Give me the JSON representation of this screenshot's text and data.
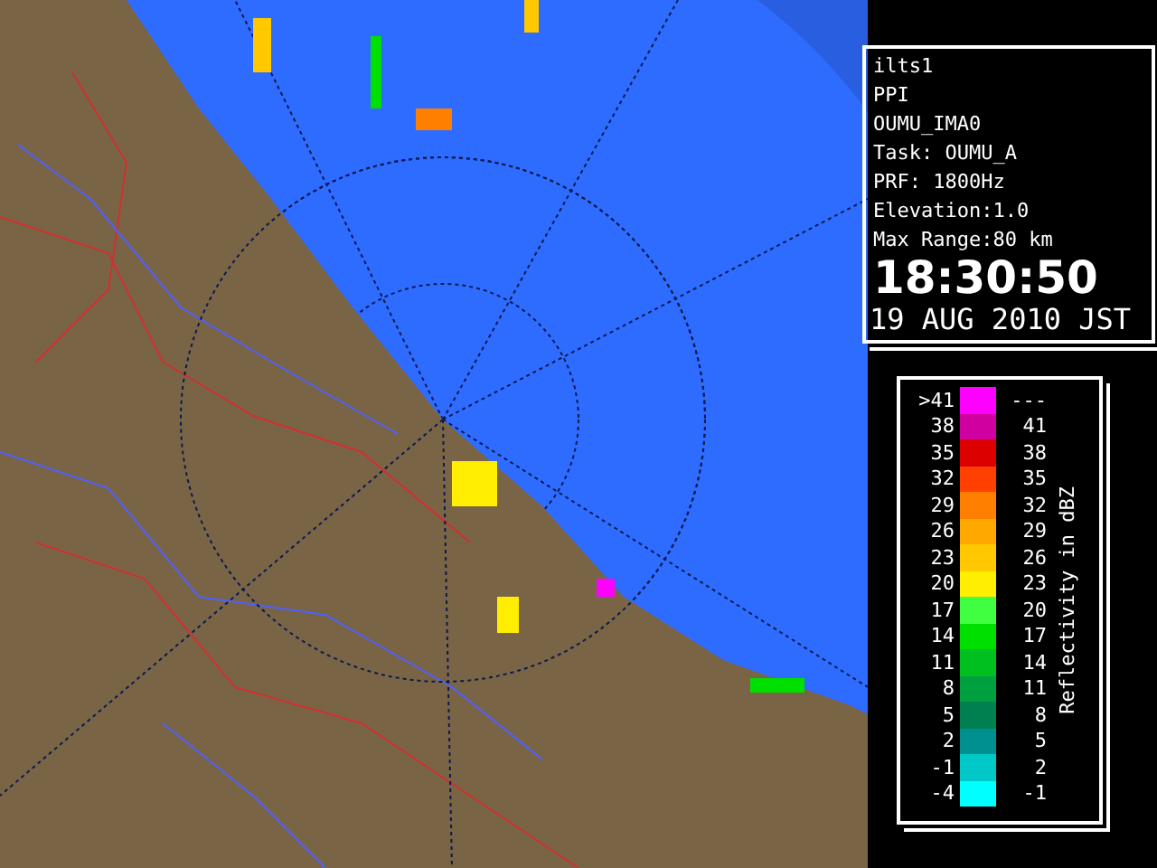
{
  "info": {
    "lines": [
      "ilts1",
      "PPI",
      "OUMU_IMA0",
      "Task: OUMU_A",
      "PRF: 1800Hz",
      "Elevation:1.0",
      "Max Range:80 km"
    ],
    "time": "18:30:50",
    "date": "19 AUG 2010 JST"
  },
  "legend": {
    "title": "Reflectivity in dBZ",
    "rows": [
      {
        "low": ">41",
        "high": "---",
        "color": "#ff00ff"
      },
      {
        "low": "38",
        "high": "41",
        "color": "#d000a0"
      },
      {
        "low": "35",
        "high": "38",
        "color": "#dd0000"
      },
      {
        "low": "32",
        "high": "35",
        "color": "#ff4000"
      },
      {
        "low": "29",
        "high": "32",
        "color": "#ff8000"
      },
      {
        "low": "26",
        "high": "29",
        "color": "#ffa800"
      },
      {
        "low": "23",
        "high": "26",
        "color": "#ffc800"
      },
      {
        "low": "20",
        "high": "23",
        "color": "#ffee00"
      },
      {
        "low": "17",
        "high": "20",
        "color": "#40ff40"
      },
      {
        "low": "14",
        "high": "17",
        "color": "#00e000"
      },
      {
        "low": "11",
        "high": "14",
        "color": "#00c020"
      },
      {
        "low": "8",
        "high": "11",
        "color": "#00a040"
      },
      {
        "low": "5",
        "high": "8",
        "color": "#008050"
      },
      {
        "low": "2",
        "high": "5",
        "color": "#009090"
      },
      {
        "low": "-1",
        "high": "2",
        "color": "#00c8c8"
      },
      {
        "low": "-4",
        "high": "-1",
        "color": "#00ffff"
      }
    ]
  }
}
